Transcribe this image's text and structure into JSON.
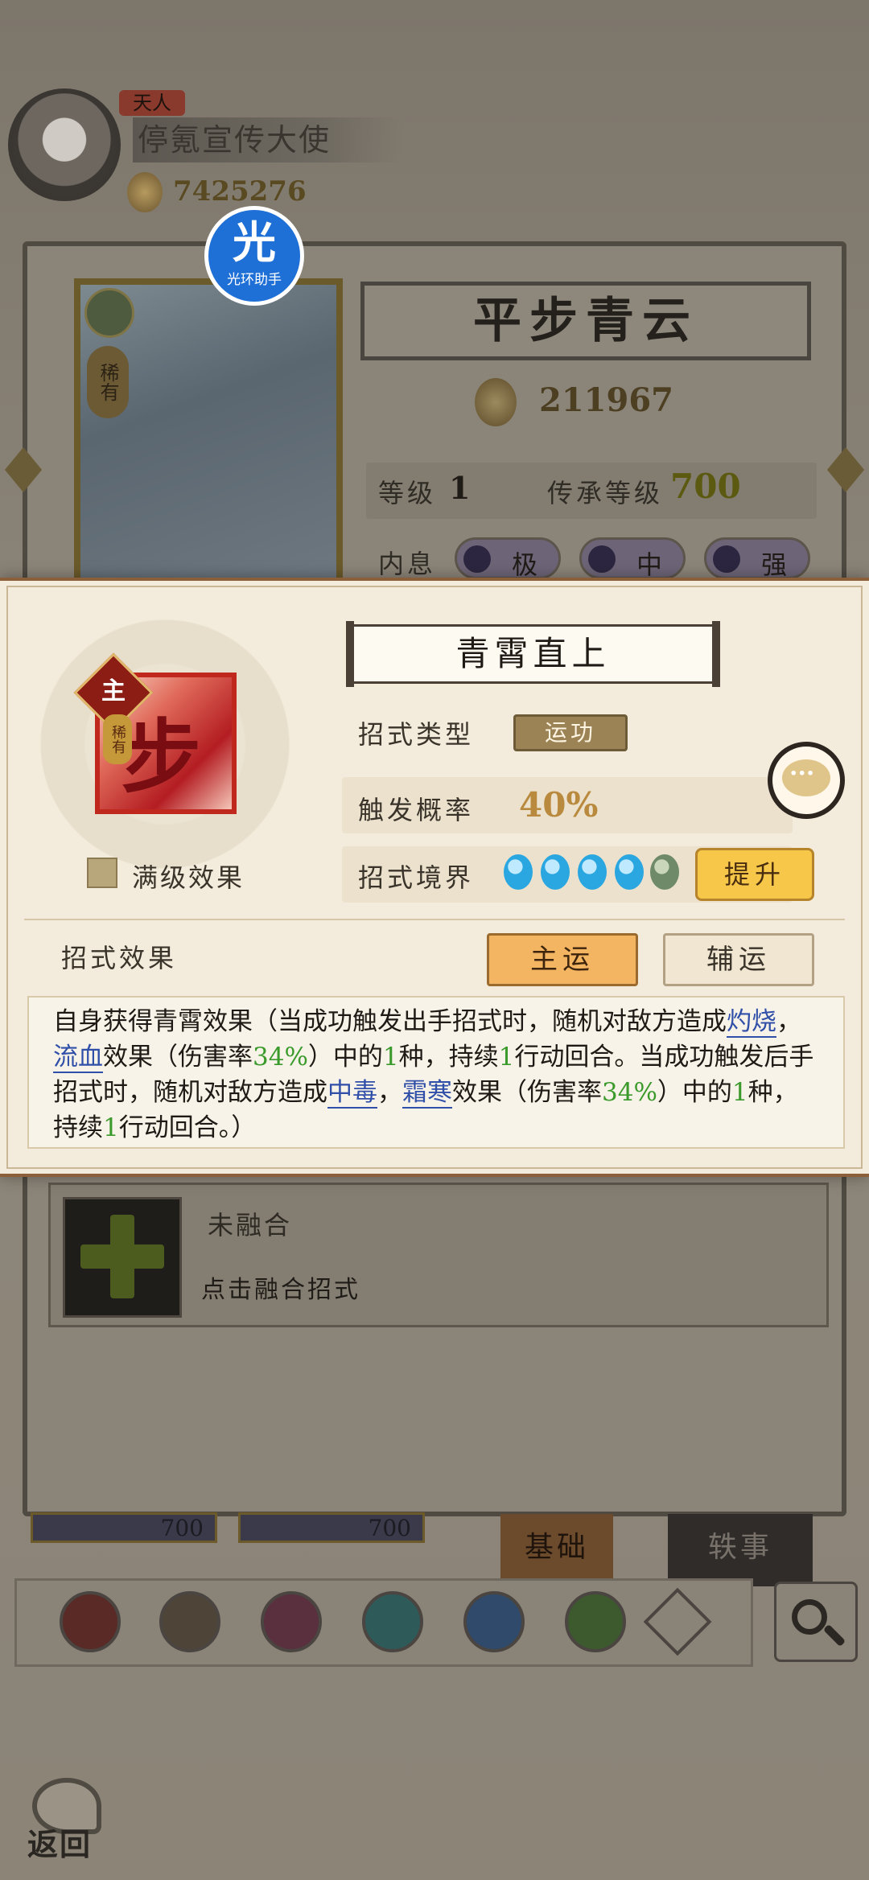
{
  "profile": {
    "rank_badge": "天人",
    "player_name": "停氪宣传大使",
    "power": "7425276"
  },
  "helper_badge": {
    "glyph": "光",
    "label": "光环助手"
  },
  "hero_card": {
    "rarity": "稀有"
  },
  "skill_panel": {
    "title": "平步青云",
    "combat_power": "211967",
    "level_label": "等级",
    "level_value": "1",
    "inherit_label": "传承等级",
    "inherit_value": "700",
    "neixi_label": "内息",
    "neixi": [
      "极",
      "中",
      "强"
    ]
  },
  "fusion": {
    "status": "未融合",
    "hint": "点击融合招式"
  },
  "bottom": {
    "chips": [
      "700",
      "700"
    ],
    "tab_basic": "基础",
    "tab_anecdote": "轶事",
    "back_label": "返回"
  },
  "modal": {
    "main_badge": "主",
    "rare_tag": "稀有",
    "max_level_label": "满级效果",
    "skill_name": "青霄直上",
    "type_label": "招式类型",
    "type_value": "运功",
    "prob_label": "触发概率",
    "prob_value": "40%",
    "realm_label": "招式境界",
    "realm_level": 4.5,
    "upgrade_label": "提升",
    "chat_glyph": "···",
    "effect_label": "招式效果",
    "mode_main": "主运",
    "mode_sub": "辅运",
    "desc": {
      "p1": "自身获得青霄效果（当成功触发出手招式时，随机对敌方造成",
      "k1": "灼烧",
      "s1": "，",
      "k2": "流血",
      "p2": "效果（伤害率",
      "n1": "34%",
      "p3": "）中的",
      "n2": "1",
      "p4": "种，持续",
      "n3": "1",
      "p5": "行动回合。当成功触发后手招式时，随机对敌方造成",
      "k3": "中毒",
      "s2": "，",
      "k4": "霜寒",
      "p6": "效果（伤害率",
      "n4": "34%",
      "p7": "）中的",
      "n5": "1",
      "p8": "种，持续",
      "n6": "1",
      "p9": "行动回合。）"
    }
  },
  "colors": {
    "modal_bg": "#f3ecdc",
    "accent_gold": "#f7c74a",
    "link_blue": "#2f4fa8",
    "number_green": "#3b9a2c",
    "prob_gold": "#b98a3e"
  }
}
